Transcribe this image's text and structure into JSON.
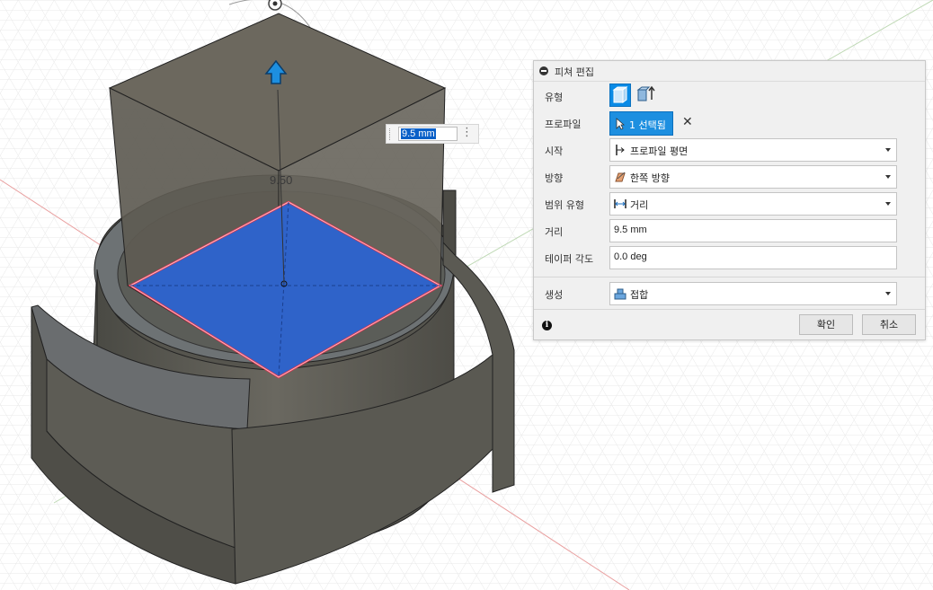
{
  "viewport": {
    "dimension_label": "9.50",
    "inline_input_value": "9.5 mm"
  },
  "dialog": {
    "title": "피쳐 편집",
    "type_label": "유형",
    "profile_label": "프로파일",
    "profile_selection": "1 선택됨",
    "start_label": "시작",
    "start_value": "프로파일 평면",
    "direction_label": "방향",
    "direction_value": "한쪽 방향",
    "extent_label": "범위 유형",
    "extent_value": "거리",
    "distance_label": "거리",
    "distance_value": "9.5 mm",
    "taper_label": "테이퍼 각도",
    "taper_value": "0.0 deg",
    "operation_label": "생성",
    "operation_value": "접합",
    "ok_label": "확인",
    "cancel_label": "취소"
  },
  "colors": {
    "accent": "#1d8fe0",
    "profile_face": "#2f63c9",
    "profile_edge": "#e0314b",
    "solid_body": "#5c5a52"
  }
}
